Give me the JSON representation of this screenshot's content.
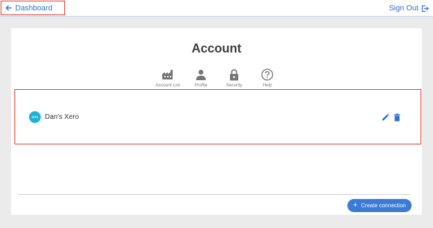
{
  "header": {
    "back_label": "Dashboard",
    "signout_label": "Sign Out"
  },
  "page": {
    "title": "Account"
  },
  "tabs": [
    {
      "label": "Account List",
      "icon": "factory-icon"
    },
    {
      "label": "Profile",
      "icon": "person-icon"
    },
    {
      "label": "Security",
      "icon": "lock-icon"
    },
    {
      "label": "Help",
      "icon": "help-icon"
    }
  ],
  "connections": [
    {
      "name": "Dan's Xero",
      "logo_text": "xero"
    }
  ],
  "footer": {
    "create_label": "Create connection"
  },
  "colors": {
    "accent": "#3a7bd5",
    "link": "#2e6fd0",
    "highlight_border": "#e0332b",
    "xero": "#1ab4d7"
  }
}
